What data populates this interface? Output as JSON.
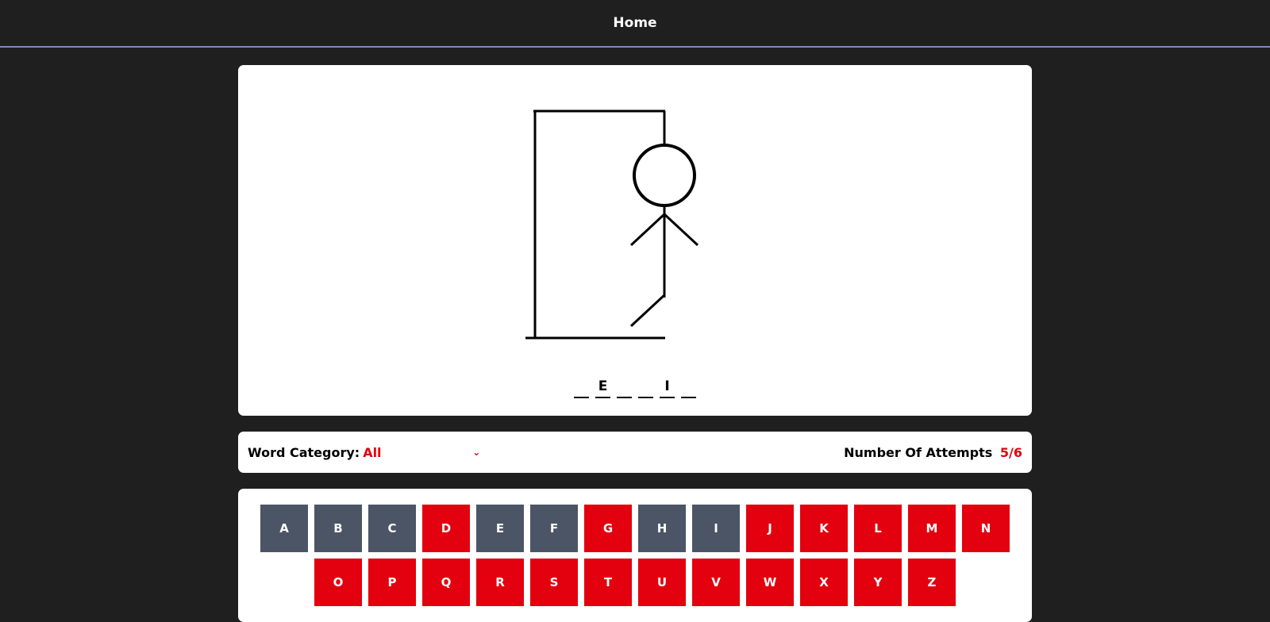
{
  "nav": {
    "home_label": "Home"
  },
  "game": {
    "word_slots": [
      "",
      "E",
      "",
      "",
      "I",
      ""
    ],
    "category_label": "Word Category:",
    "category_value": "All",
    "attempts_label": "Number Of Attempts",
    "attempts_value": "5/6"
  },
  "keyboard": {
    "row1": [
      {
        "letter": "A",
        "state": "used"
      },
      {
        "letter": "B",
        "state": "used"
      },
      {
        "letter": "C",
        "state": "used"
      },
      {
        "letter": "D",
        "state": "available"
      },
      {
        "letter": "E",
        "state": "used"
      },
      {
        "letter": "F",
        "state": "used"
      },
      {
        "letter": "G",
        "state": "available"
      },
      {
        "letter": "H",
        "state": "used"
      },
      {
        "letter": "I",
        "state": "used"
      },
      {
        "letter": "J",
        "state": "available"
      },
      {
        "letter": "K",
        "state": "available"
      },
      {
        "letter": "L",
        "state": "available"
      },
      {
        "letter": "M",
        "state": "available"
      },
      {
        "letter": "N",
        "state": "available"
      }
    ],
    "row2": [
      {
        "letter": "O",
        "state": "available"
      },
      {
        "letter": "P",
        "state": "available"
      },
      {
        "letter": "Q",
        "state": "available"
      },
      {
        "letter": "R",
        "state": "available"
      },
      {
        "letter": "S",
        "state": "available"
      },
      {
        "letter": "T",
        "state": "available"
      },
      {
        "letter": "U",
        "state": "available"
      },
      {
        "letter": "V",
        "state": "available"
      },
      {
        "letter": "W",
        "state": "available"
      },
      {
        "letter": "X",
        "state": "available"
      },
      {
        "letter": "Y",
        "state": "available"
      },
      {
        "letter": "Z",
        "state": "available"
      }
    ]
  },
  "colors": {
    "accent": "#e3000f",
    "used_key": "#4b5565",
    "background": "#1f1f1f",
    "nav_border": "#7d8bb3"
  }
}
